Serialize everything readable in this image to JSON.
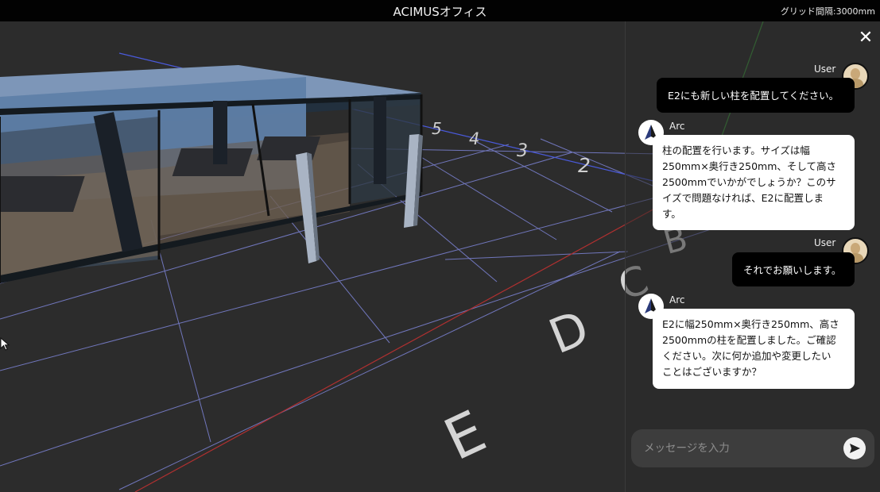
{
  "app": {
    "title": "ACIMUSオフィス",
    "grid_info": "グリッド間隔:3000mm"
  },
  "scene": {
    "column_labels": [
      "5",
      "4",
      "3",
      "2"
    ],
    "row_labels": [
      "B",
      "C",
      "D",
      "E"
    ]
  },
  "chat": {
    "close_label": "✕",
    "messages": [
      {
        "role": "User",
        "text": "E2にも新しい柱を配置してください。"
      },
      {
        "role": "Arc",
        "lines": [
          "柱の配置を行います。サイズは幅",
          "250mm×奥行き250mm、そして高さ",
          "2500mmでいかがでしょうか？このサ",
          "イズで問題なければ、E2に配置しま",
          "す。"
        ]
      },
      {
        "role": "User",
        "text": "それでお願いします。"
      },
      {
        "role": "Arc",
        "lines": [
          "E2に幅250mm×奥行き250mm、高さ",
          "2500mmの柱を配置しました。ご確認",
          "ください。次に何か追加や変更したい",
          "ことはございますか？"
        ]
      }
    ],
    "input": {
      "value": "",
      "placeholder": "メッセージを入力"
    }
  },
  "colors": {
    "grid_line": "#8a90e0",
    "axis_red": "#b03030",
    "axis_green": "#3a9a3a",
    "axis_blue": "#4a5adc"
  }
}
